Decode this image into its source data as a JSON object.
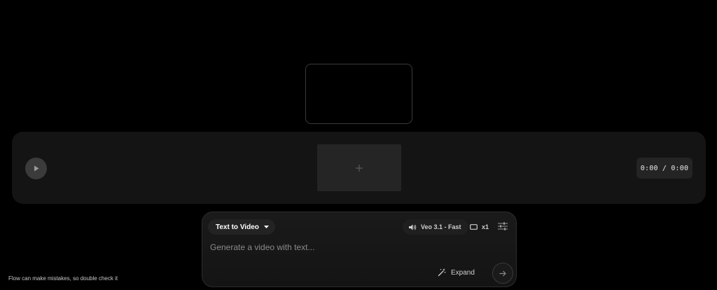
{
  "timeline": {
    "time_readout": "0:00 / 0:00"
  },
  "prompt": {
    "mode_label": "Text to Video",
    "model_label": "Veo 3.1 - Fast",
    "count_label": "x1",
    "placeholder": "Generate a video with text...",
    "expand_label": "Expand"
  },
  "footer": {
    "disclaimer": "Flow can make mistakes, so double check it"
  },
  "icons": {
    "play": "play-icon",
    "add": "plus-icon",
    "mode_dropdown": "caret-down-icon",
    "audio": "speaker-icon",
    "aspect": "aspect-ratio-icon",
    "settings": "sliders-icon",
    "expand": "magic-wand-icon",
    "send": "arrow-right-icon"
  }
}
